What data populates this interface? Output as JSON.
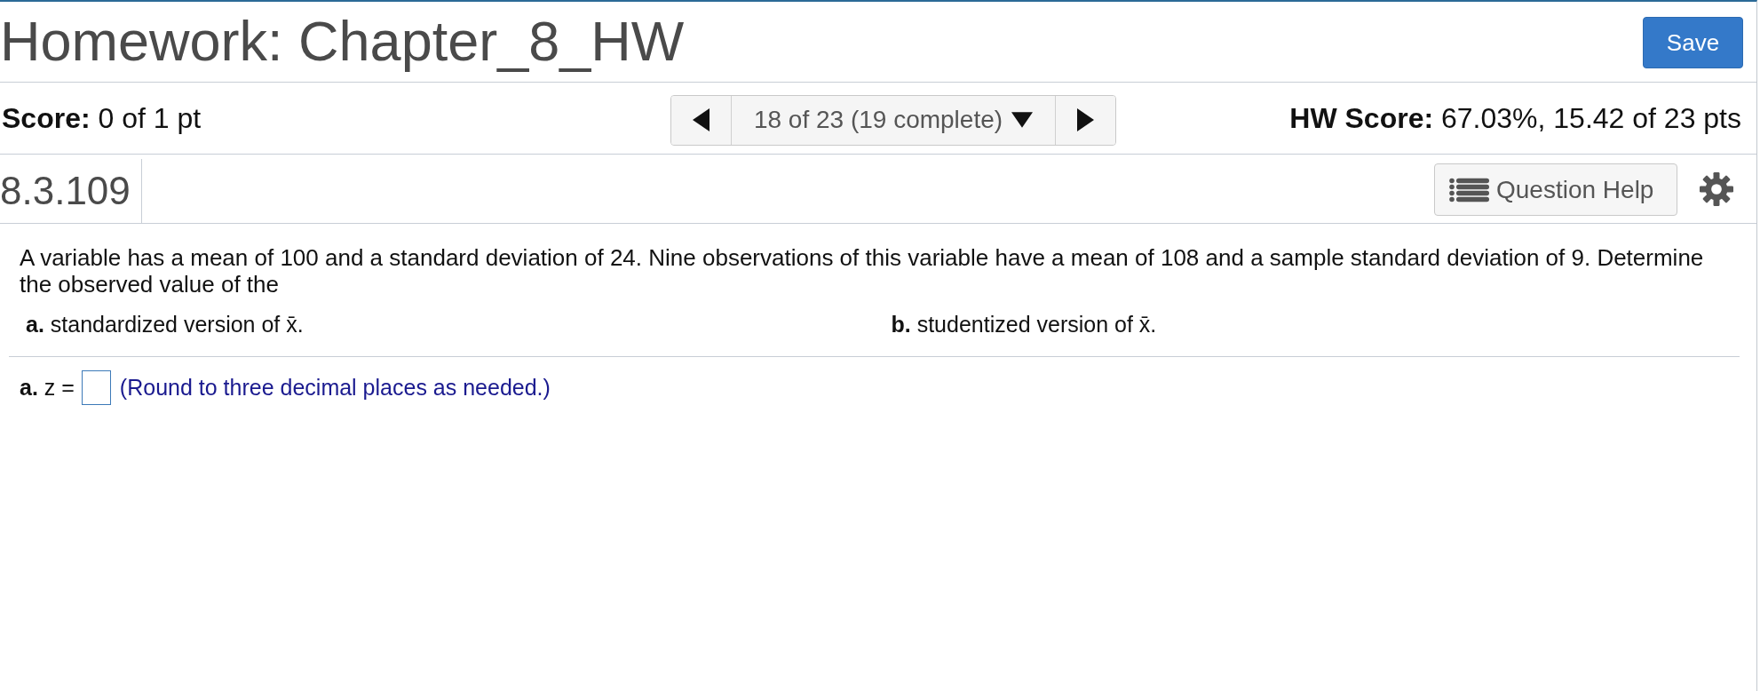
{
  "header": {
    "title": "Homework: Chapter_8_HW",
    "save_button": "Save"
  },
  "score_bar": {
    "score": "**Score:** 0 of 1 pt",
    "navigator": {
      "position": "18 of 23 (19 complete)"
    },
    "hw_score": "**HW Score:** 67.03%, 15.42 of 23 pts"
  },
  "question_bar": {
    "number": "8.3.109",
    "help_button": "Question Help"
  },
  "question": {
    "text": "A variable has a mean of 100 and a standard deviation of 24. Nine observations of this variable have a mean of 108 and a sample standard deviation of 9. Determine the observed value of the",
    "parts": [
      "**a.** standardized version of x̄.",
      "**b.** studentized version of x̄."
    ]
  },
  "answer": {
    "label": "**a.** z =",
    "hint": "(Round to three decimal places as needed.)"
  }
}
